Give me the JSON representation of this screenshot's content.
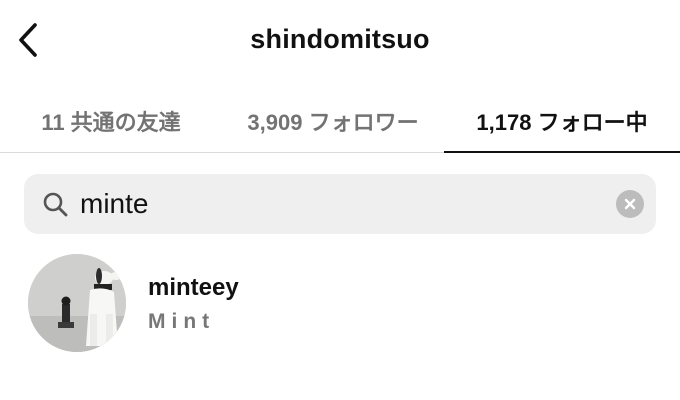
{
  "header": {
    "title": "shindomitsuo",
    "back_icon": "chevron-left-icon"
  },
  "tabs": [
    {
      "label": "11 共通の友達",
      "active": false
    },
    {
      "label": "3,909 フォロワー",
      "active": false
    },
    {
      "label": "1,178 フォロー中",
      "active": true
    }
  ],
  "search": {
    "value": "minte",
    "icon": "search-icon",
    "clear_icon": "clear-icon"
  },
  "results": [
    {
      "username": "minteey",
      "full_name": "Mint",
      "avatar_icon": "avatar"
    }
  ],
  "colors": {
    "text_primary": "#111111",
    "text_secondary": "#737373",
    "search_bg": "#efefef",
    "divider": "#dbdbdb"
  }
}
